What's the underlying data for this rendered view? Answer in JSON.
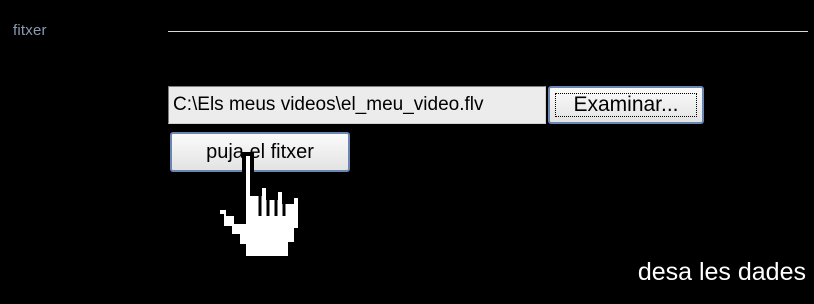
{
  "section": {
    "label": "fitxer"
  },
  "file_input": {
    "value": "C:\\Els meus videos\\el_meu_video.flv"
  },
  "buttons": {
    "browse_label": "Examinar...",
    "upload_label": "puja el fitxer"
  },
  "footer": {
    "save_label": "desa les dades"
  },
  "cursor": {
    "icon": "hand-pointer-icon"
  },
  "colors": {
    "background": "#000000",
    "label": "#8a9bb1",
    "divider": "#d9d9d9",
    "button_border": "#6a87b4",
    "save_text": "#ffffff"
  }
}
